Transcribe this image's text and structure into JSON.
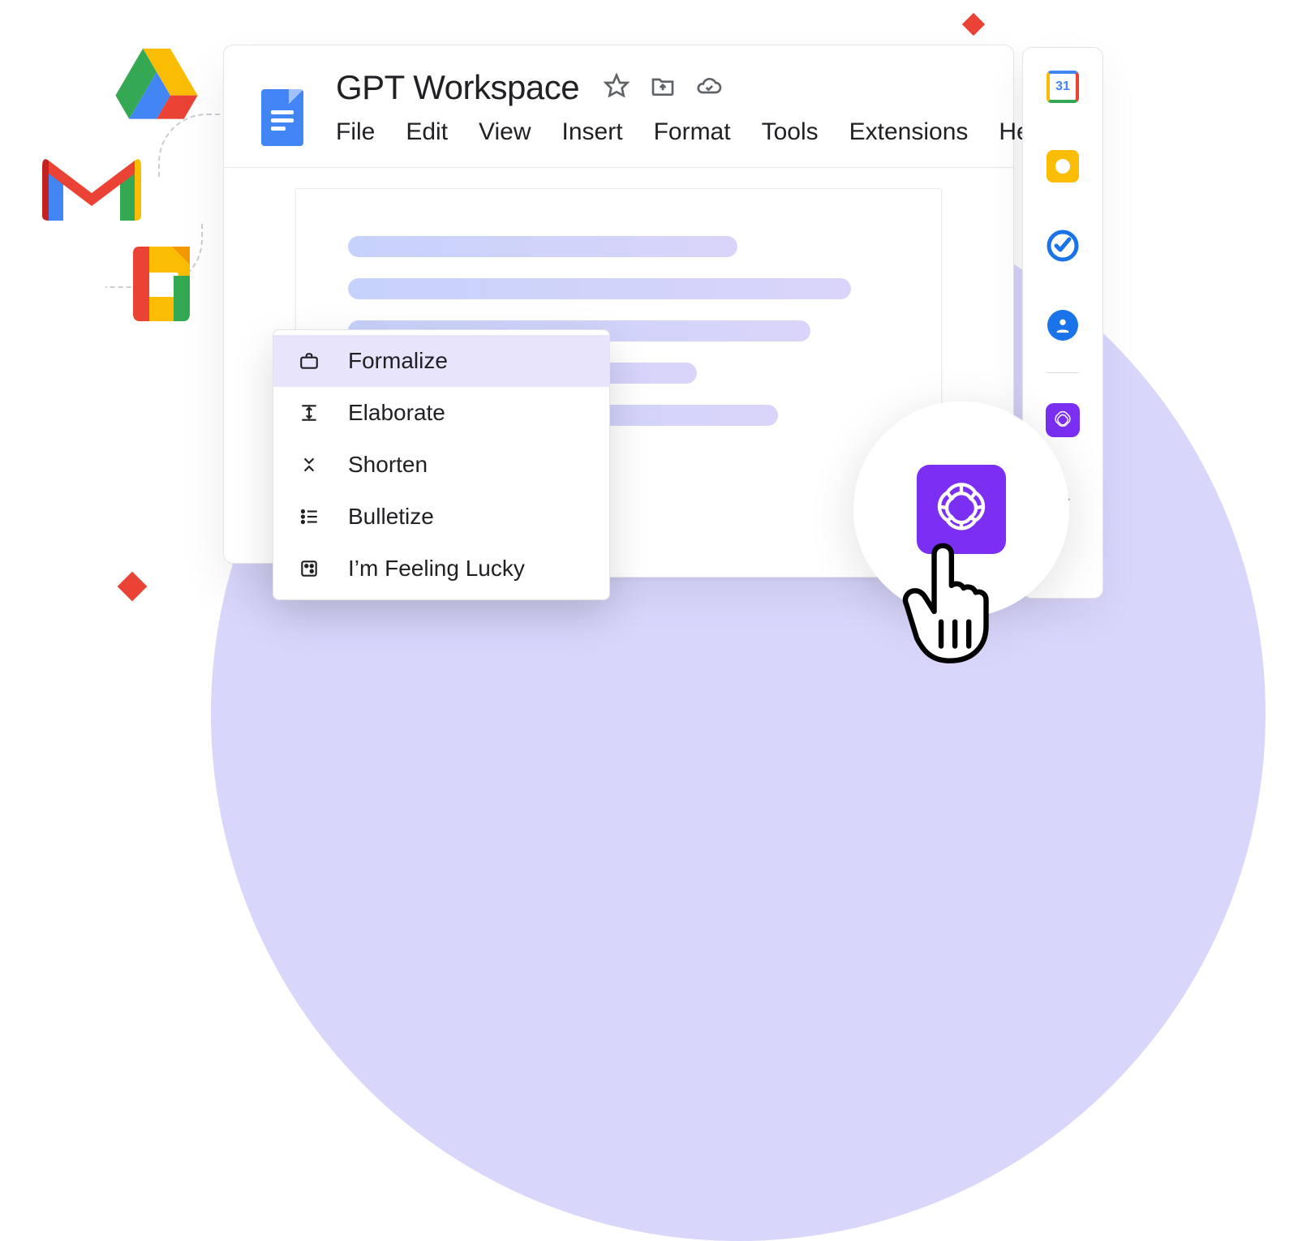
{
  "doc": {
    "title": "GPT Workspace",
    "menu": {
      "file": "File",
      "edit": "Edit",
      "view": "View",
      "insert": "Insert",
      "format": "Format",
      "tools": "Tools",
      "extensions": "Extensions",
      "help": "Help"
    }
  },
  "context_menu": {
    "items": [
      {
        "icon": "briefcase",
        "label": "Formalize",
        "active": true
      },
      {
        "icon": "expand-v",
        "label": "Elaborate"
      },
      {
        "icon": "collapse-v",
        "label": "Shorten"
      },
      {
        "icon": "list-ul",
        "label": "Bulletize"
      },
      {
        "icon": "dice",
        "label": "I’m Feeling Lucky"
      }
    ]
  },
  "side_panel": {
    "calendar_day": "31"
  },
  "colors": {
    "brand_purple": "#7b2ff2",
    "google_blue": "#4285f4",
    "google_red": "#ea4335",
    "google_yellow": "#fbbc04",
    "google_green": "#34a853"
  }
}
